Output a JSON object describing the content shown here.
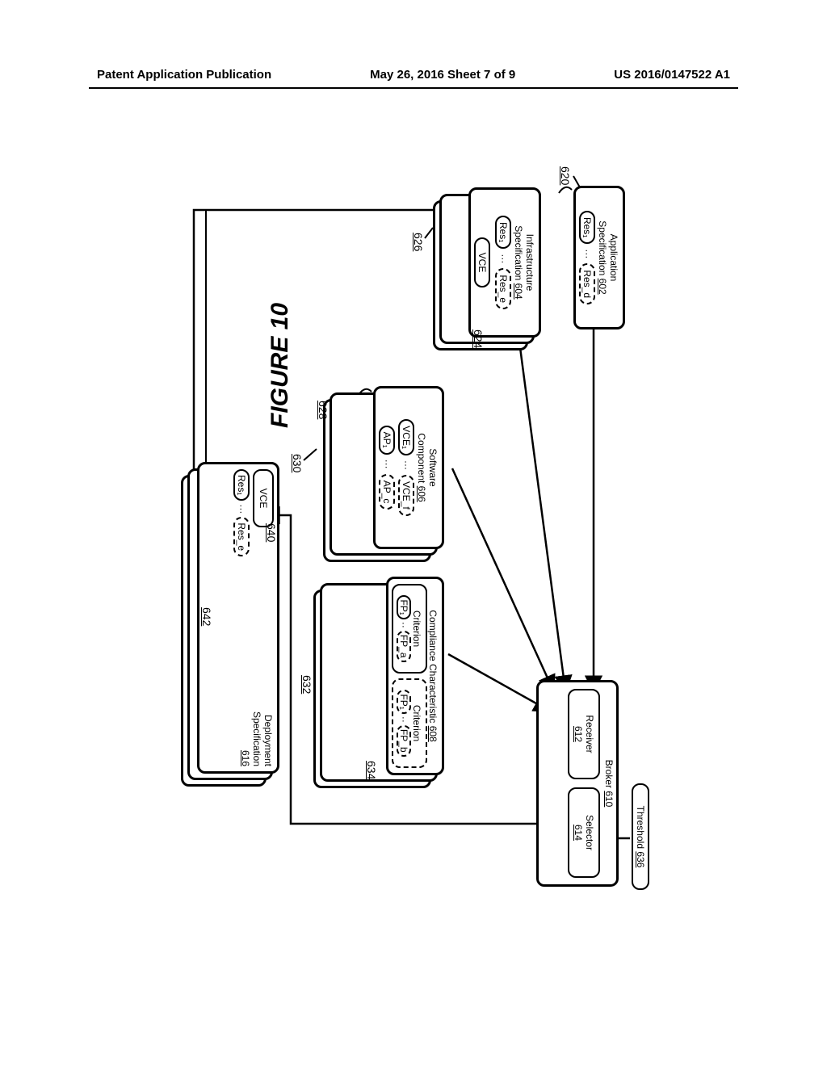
{
  "header": {
    "left": "Patent Application Publication",
    "center": "May 26, 2016  Sheet 7 of 9",
    "right": "US 2016/0147522 A1"
  },
  "figure_title": "FIGURE 10",
  "app_spec": {
    "title": "Application\nSpecification",
    "ref": "602",
    "res_first": "Res₁",
    "res_last": "Res_d"
  },
  "infra_spec": {
    "title": "Infrastructure\nSpecification",
    "ref": "604",
    "res_first": "Res₁",
    "res_last": "Res_e",
    "vce": "VCE"
  },
  "sw_component": {
    "title": "Software\nComponent",
    "ref": "606",
    "vce_first": "VCE₁",
    "vce_last": "VCE_f",
    "ap_first": "AP₁",
    "ap_last": "AP_c"
  },
  "compliance": {
    "title": "Compliance Characteristic",
    "ref": "608",
    "crit1": {
      "title": "Criterion",
      "fp_first": "FP₁",
      "fp_last": "FP_a"
    },
    "crit2": {
      "title": "Criterion",
      "fp_first": "FP₁",
      "fp_last": "FP_b"
    }
  },
  "broker": {
    "title": "Broker",
    "ref": "610"
  },
  "receiver": {
    "title": "Receiver",
    "ref": "612"
  },
  "selector": {
    "title": "Selector",
    "ref": "614"
  },
  "threshold": {
    "title": "Threshold",
    "ref": "636"
  },
  "deploy_spec": {
    "title": "Deployment\nSpecification",
    "ref": "616",
    "vce": "VCE",
    "res_first": "Res₁",
    "res_last": "Res_e"
  },
  "callouts": {
    "n620": "620",
    "n624": "624",
    "n626": "626",
    "n628": "628",
    "n630": "630",
    "n632": "632",
    "n634": "634",
    "n640": "640",
    "n642": "642"
  }
}
